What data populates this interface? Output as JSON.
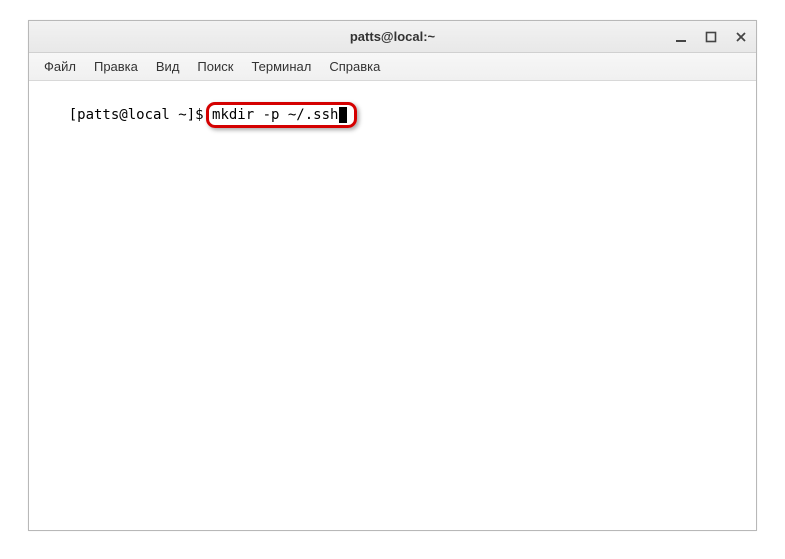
{
  "window": {
    "title": "patts@local:~"
  },
  "menu": {
    "file": "Файл",
    "edit": "Правка",
    "view": "Вид",
    "search": "Поиск",
    "terminal": "Терминал",
    "help": "Справка"
  },
  "terminal": {
    "prompt": "[patts@local ~]$ ",
    "command": "mkdir -p ~/.ssh"
  }
}
